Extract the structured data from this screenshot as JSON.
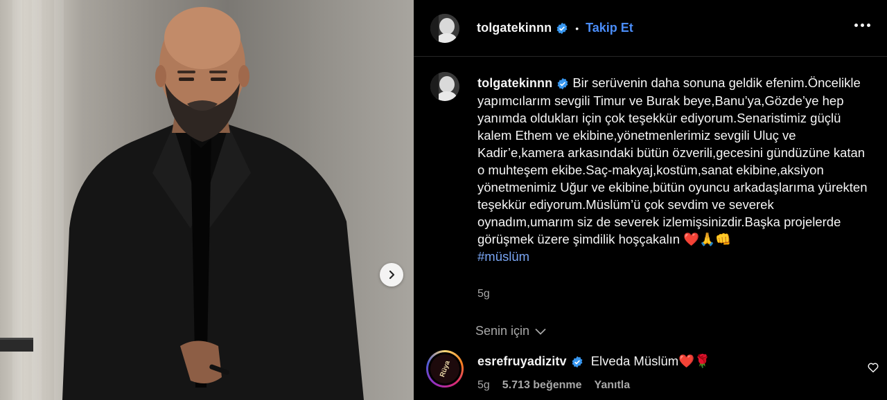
{
  "post": {
    "username": "tolgatekinnn",
    "follow_label": "Takip Et",
    "dot": "•",
    "caption": "Bir serüvenin daha sonuna geldik efenim.Öncelikle yapımcılarım sevgili Timur ve Burak beye,Banu’ya,Gözde’ye hep yanımda oldukları için çok teşekkür ediyorum.Senaristimiz güçlü kalem Ethem ve ekibine,yönetmenlerimiz sevgili Uluç ve Kadir’e,kamera arkasındaki bütün özverili,gecesini gündüzüne katan o muhteşem ekibe.Saç-makyaj,kostüm,sanat ekibine,aksiyon yönetmenimiz Uğur ve ekibine,bütün oyuncu arkadaşlarıma yürekten teşekkür ediyorum.Müslüm’ü çok sevdim ve severek oynadım,umarım siz de severek izlemişsinizdir.Başka projelerde görüşmek üzere şimdilik hoşçakalın ❤️🙏👊",
    "hashtag": "#müslüm",
    "time": "5g"
  },
  "filter": {
    "label": "Senin için"
  },
  "comment": {
    "username": "esrefruyadizitv",
    "text": "Elveda Müslüm❤️🌹",
    "avatar_text": "Rüya",
    "time": "5g",
    "likes": "5.713 beğenme",
    "reply_label": "Yanıtla"
  },
  "colors": {
    "accent": "#4a8cf7",
    "hashtag": "#7aa6f4",
    "verified": "#3897f0",
    "muted": "#a8a8a8"
  }
}
